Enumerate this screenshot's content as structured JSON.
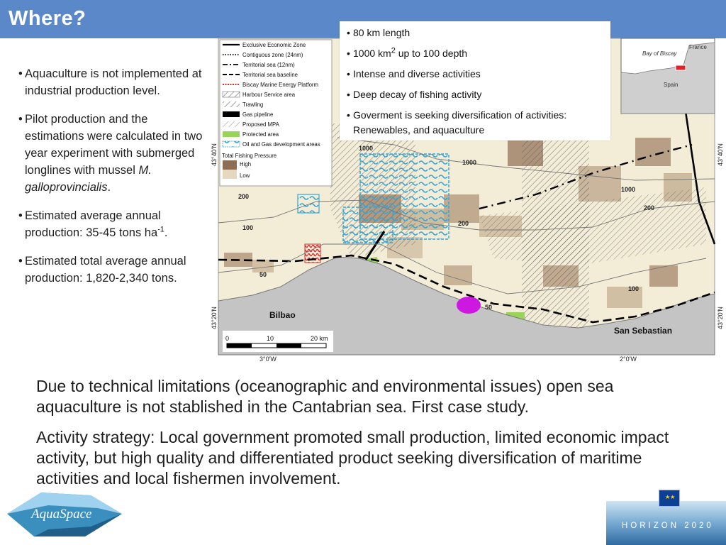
{
  "header": {
    "title": "Where?"
  },
  "left_bullets": {
    "b1": "Aquaculture is not implemented at industrial production level.",
    "b2_pre": "Pilot production and the estimations were calculated in two year experiment with submerged longlines with mussel ",
    "b2_species": "M. galloprovincialis",
    "b2_post": ".",
    "b3_pre": "Estimated average annual production: 35-45   tons ha",
    "b3_sup": "-1",
    "b3_post": ".",
    "b4": "Estimated total average annual production: 1,820-2,340 tons."
  },
  "info_box": {
    "i1": "80 km length",
    "i2_pre": "1000 km",
    "i2_sup": "2",
    "i2_post": " up to 100 depth",
    "i3": "Intense and diverse activities",
    "i4": "Deep decay of fishing activity",
    "i5": "Goverment is seeking diversification of activities: Renewables, and aquaculture"
  },
  "map": {
    "legend": [
      "Exclusive Economic Zone",
      "Contiguous zone (24nm)",
      "Territorial sea (12nm)",
      "Territorial sea baseline",
      "Biscay Marine Energy Platform",
      "Harbour Service area",
      "Trawling",
      "Gas pipeline",
      "Proposed MPA",
      "Protected area",
      "Oil and Gas development areas"
    ],
    "pressure_title": "Total Fishing Pressure",
    "pressure_high": "High",
    "pressure_low": "Low",
    "lat_top": "43°40'N",
    "lat_bottom": "43°20'N",
    "lon_left": "3°0'W",
    "lon_right": "2°0'W",
    "city_bilbao": "Bilbao",
    "city_sansebastian": "San Sebastian",
    "scale": {
      "s0": "0",
      "s10": "10",
      "s20": "20 km"
    },
    "depths": {
      "d1000a": "1000",
      "d1000b": "1000",
      "d1000c": "1000",
      "d200a": "200",
      "d200b": "200",
      "d200c": "200",
      "d100a": "100",
      "d100b": "100",
      "d50a": "50",
      "d50b": "50"
    },
    "inset": {
      "bay": "Bay of Biscay",
      "france": "France",
      "spain": "Spain"
    }
  },
  "body": {
    "p1": "Due to technical limitations (oceanographic and environmental issues) open sea aquaculture is not stablished in the Cantabrian sea. First case study.",
    "p2": "Activity strategy: Local government promoted small production, limited economic impact activity, but high quality and differentiated product seeking diversification of maritime activities and local fishermen involvement."
  },
  "logos": {
    "aquaspace": "AquaSpace",
    "horizon": "HORIZON 2020"
  }
}
